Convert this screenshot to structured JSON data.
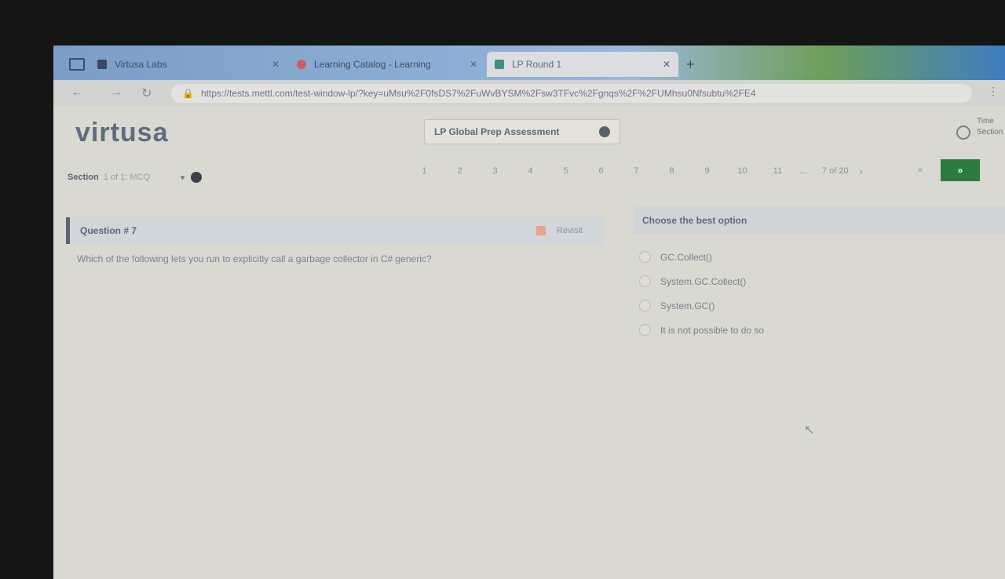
{
  "browser": {
    "tabs": [
      {
        "title": "Virtusa Labs",
        "favicon_color": "#3d4760"
      },
      {
        "title": "Learning Catalog - Learning",
        "favicon_color": "#d65a64"
      },
      {
        "title": "LP Round 1",
        "favicon_color": "#3d8f86"
      }
    ],
    "new_tab_glyph": "+",
    "url": "https://tests.mettl.com/test-window-lp/?key=uMsu%2F0fsDS7%2FuWvBYSM%2Fsw3TFvc%2Fgnqs%2F%2FUMhsu0Nfsubtu%2FE4"
  },
  "header": {
    "logo": "virtusa",
    "assessment_title": "LP Global Prep Assessment",
    "timer_label": "Time\nSection"
  },
  "section": {
    "label": "Section",
    "selected": "1 of 1: MCQ"
  },
  "pager": {
    "pages": [
      "1",
      "2",
      "3",
      "4",
      "5",
      "6",
      "7",
      "8",
      "9",
      "10",
      "11",
      "..."
    ],
    "page_info": "7 of 20",
    "prev_label": "«",
    "next_label": "»"
  },
  "question": {
    "title": "Question # 7",
    "review_label": "Revisit",
    "text": "Which of the following lets you run to explicitly call a garbage collector in C# generic?"
  },
  "answer": {
    "heading": "Choose the best option",
    "options": [
      "GC.Collect()",
      "System.GC.Collect()",
      "System.GC()",
      "It is not possible to do so"
    ]
  },
  "colors": {
    "next_button": "#2e7b40",
    "page_bg": "#d9d8d1",
    "question_header_bg": "#d1d6db"
  }
}
